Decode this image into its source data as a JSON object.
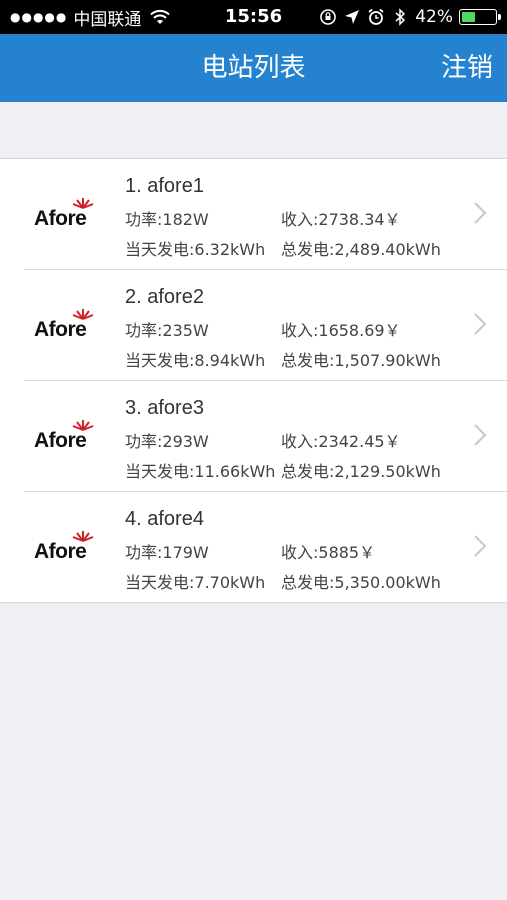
{
  "status_bar": {
    "signal_dots": "●●●●●",
    "carrier": "中国联通",
    "time": "15:56",
    "battery_percent_text": "42%",
    "battery_level": 0.42
  },
  "nav": {
    "title": "电站列表",
    "logout_label": "注销"
  },
  "stations": [
    {
      "name": "1. afore1",
      "logo_text": "Afore",
      "power": "功率:182W",
      "income": "收入:2738.34￥",
      "today_energy": "当天发电:6.32kWh",
      "total_energy": "总发电:2,489.40kWh"
    },
    {
      "name": "2. afore2",
      "logo_text": "Afore",
      "power": "功率:235W",
      "income": "收入:1658.69￥",
      "today_energy": "当天发电:8.94kWh",
      "total_energy": "总发电:1,507.90kWh"
    },
    {
      "name": "3. afore3",
      "logo_text": "Afore",
      "power": "功率:293W",
      "income": "收入:2342.45￥",
      "today_energy": "当天发电:11.66kWh",
      "total_energy": "总发电:2,129.50kWh"
    },
    {
      "name": "4. afore4",
      "logo_text": "Afore",
      "power": "功率:179W",
      "income": "收入:5885￥",
      "today_energy": "当天发电:7.70kWh",
      "total_energy": "总发电:5,350.00kWh"
    }
  ]
}
